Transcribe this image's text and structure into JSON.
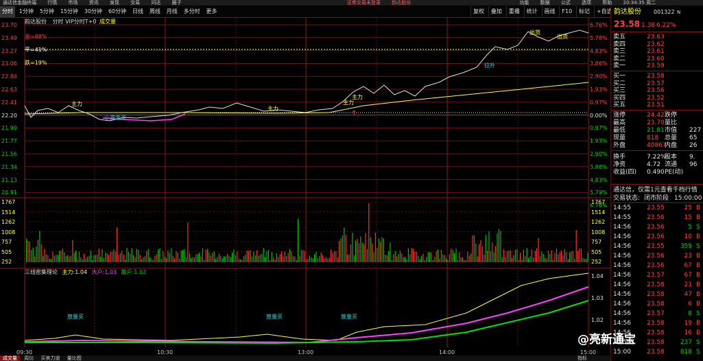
{
  "titlebar": {
    "app": "通达信金融终端",
    "menus": [
      "行情",
      "市场",
      "资讯",
      "发现",
      "交易",
      "问达",
      "圈子"
    ],
    "center": [
      "证券交易未登录",
      "韵达股份"
    ],
    "right": [
      "功能",
      "数据",
      "公式",
      "选项",
      "帮助"
    ],
    "clock": "20:34:35 周二"
  },
  "period_tabs": [
    "分时",
    "1分钟",
    "5分钟",
    "15分钟",
    "30分钟",
    "60分钟",
    "日线",
    "周线",
    "月线",
    "多分时",
    "更多"
  ],
  "toolbar": [
    "叠加",
    "重播",
    "统计",
    "画线",
    "F10",
    "标记",
    "+自选",
    "返回"
  ],
  "toolbar_first": "复权",
  "chart": {
    "stock_name": "韵达股份",
    "header": "分时 VIP分时T+0",
    "vol_tag": "成交量",
    "pct_tags": [
      {
        "label": "涨=68%",
        "color": "#ff4040"
      },
      {
        "label": "平=41%",
        "color": "#ffffff"
      },
      {
        "label": "跌=19%",
        "color": "#ffff3c"
      }
    ],
    "price_left": [
      "23.70",
      "23.49",
      "23.27",
      "23.06",
      "22.84",
      "22.63",
      "22.41",
      "22.20",
      "21.99",
      "21.77",
      "21.56",
      "21.34",
      "21.13",
      "20.91"
    ],
    "pct_right": [
      "6.76%",
      "5.78%",
      "4.83%",
      "3.86%",
      "2.90%",
      "1.93%",
      "0.97%",
      "0.00%",
      "0.97%",
      "1.93%",
      "2.90%",
      "3.86%",
      "4.83%",
      "5.79%",
      "6.76%"
    ],
    "vol_labels": [
      "1767",
      "1514",
      "1262",
      "1008",
      "757",
      "505",
      "252"
    ],
    "ind_title": "三线密集理论",
    "ind_main_label": "主力:",
    "ind_main_val": "1.04",
    "ind_big_label": "大户:",
    "ind_big_val": "1.03",
    "ind_small_label": "散户:",
    "ind_small_val": "1.02",
    "ind_right": [
      "1.04",
      "1.03",
      "1.02"
    ],
    "time_labels": [
      "09:30",
      "10:30",
      "13:00",
      "14:00",
      "15:00"
    ],
    "signals": [
      "主力",
      "主力",
      "主力",
      "主力"
    ],
    "signal_small": "小资金买",
    "signals_up": [
      "拉升",
      "出货",
      "出货"
    ],
    "ind_signals": [
      "放量买",
      "放量买",
      "放量买"
    ],
    "up_arrow": "↑"
  },
  "right_panel": {
    "name": "韵达股份",
    "code": "001322",
    "flag": "N",
    "price": "23.58",
    "change": "1.38",
    "change_pct": "6.22%",
    "asks": [
      {
        "l": "卖五",
        "p": "23.63"
      },
      {
        "l": "卖四",
        "p": "23.62"
      },
      {
        "l": "卖三",
        "p": "23.61"
      },
      {
        "l": "卖二",
        "p": "23.60"
      },
      {
        "l": "卖一",
        "p": "23.59"
      }
    ],
    "bids": [
      {
        "l": "买一",
        "p": "23.58"
      },
      {
        "l": "买二",
        "p": "23.57"
      },
      {
        "l": "买三",
        "p": "23.56"
      },
      {
        "l": "买四",
        "p": "23.52"
      },
      {
        "l": "买五",
        "p": "23.51"
      }
    ],
    "stats": [
      {
        "a": "涨停",
        "av": "24.42",
        "b": "跌停",
        "bv": ""
      },
      {
        "a": "最高",
        "av": "23.70",
        "b": "量比",
        "bv": ""
      },
      {
        "a": "最低",
        "av": "21.81",
        "b": "市值",
        "bv": "227"
      },
      {
        "a": "现量",
        "av": "818",
        "b": "总量",
        "bv": "65"
      },
      {
        "a": "外盘",
        "av": "40867",
        "b": "内盘",
        "bv": "26"
      }
    ],
    "stats2": [
      {
        "a": "换手",
        "av": "7.22%",
        "b": "股本",
        "bv": "9."
      },
      {
        "a": "净资",
        "av": "4.72",
        "b": "流通",
        "bv": "96"
      },
      {
        "a": "收益(四)",
        "av": "0.490",
        "b": "PE(动)",
        "bv": ""
      }
    ],
    "notice": "通达信，仅需1元查看千档行情",
    "status_label": "交易状态:",
    "status_val": "闭市阶段",
    "status_time": "15:00:00",
    "ticks": [
      {
        "t": "14:55",
        "p": "23.55",
        "v": "25",
        "d": "B"
      },
      {
        "t": "14:55",
        "p": "23.56",
        "v": "15",
        "d": "B"
      },
      {
        "t": "14:56",
        "p": "23.56",
        "v": "5",
        "d": "S"
      },
      {
        "t": "14:56",
        "p": "23.56",
        "v": "10",
        "d": "B"
      },
      {
        "t": "14:56",
        "p": "23.55",
        "v": "359",
        "d": "S"
      },
      {
        "t": "14:56",
        "p": "23.56",
        "v": "23",
        "d": "B"
      },
      {
        "t": "14:56",
        "p": "23.56",
        "v": "67",
        "d": "B"
      },
      {
        "t": "14:56",
        "p": "23.57",
        "v": "67",
        "d": "B"
      },
      {
        "t": "14:56",
        "p": "23.58",
        "v": "21",
        "d": "B"
      },
      {
        "t": "14:56",
        "p": "23.58",
        "v": "47",
        "d": "B"
      },
      {
        "t": "14:56",
        "p": "23.58",
        "v": "6",
        "d": "B"
      },
      {
        "t": "14:56",
        "p": "23.57",
        "v": "8",
        "d": "S"
      },
      {
        "t": "14:56",
        "p": "23.58",
        "v": "19",
        "d": "B"
      },
      {
        "t": "14:56",
        "p": "23.58",
        "v": "16",
        "d": "B"
      },
      {
        "t": "14:56",
        "p": "23.58",
        "v": "237",
        "d": "S"
      },
      {
        "t": "15:00",
        "p": "23.58",
        "v": "818",
        "d": "S"
      }
    ]
  },
  "bottombar": [
    "成交量",
    "周比",
    "买卖力道",
    "量比图"
  ],
  "bottom_right": "指标",
  "watermark": "@亮新通宝"
}
